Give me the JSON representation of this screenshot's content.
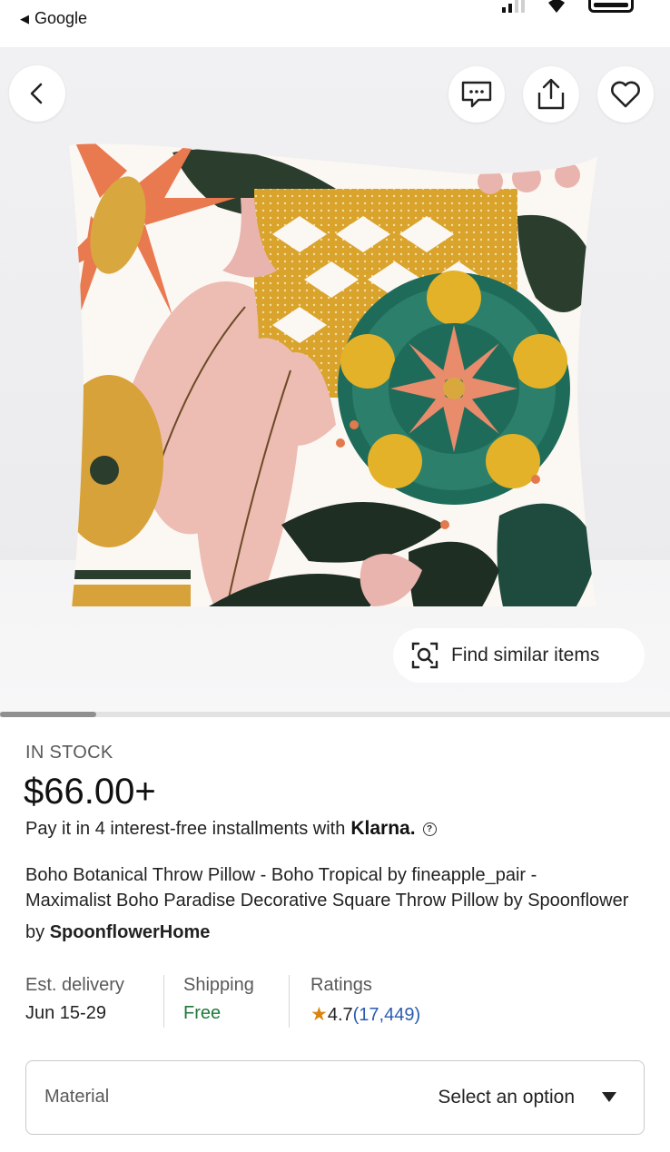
{
  "status_bar": {
    "back_app_label": "Google"
  },
  "hero": {
    "icons": {
      "back": "chevron-left-icon",
      "message": "message-icon",
      "share": "share-icon",
      "favorite": "heart-icon",
      "visual_search": "visual-search-icon"
    },
    "find_similar_label": "Find similar items",
    "image_index": 1
  },
  "product": {
    "stock_status": "IN STOCK",
    "price": "$66.00+",
    "installments_text": "Pay it in 4 interest-free installments with",
    "installments_provider": "Klarna.",
    "title_line1": "Boho Botanical Throw Pillow - Boho Tropical by fineapple_pair -",
    "title_line2": "Maximalist  Boho Paradise Decorative Square Throw Pillow by Spoonflower",
    "seller_prefix": "by",
    "seller_name": "SpoonflowerHome"
  },
  "meta": {
    "delivery_label": "Est. delivery",
    "delivery_value": "Jun 15-29",
    "shipping_label": "Shipping",
    "shipping_value": "Free",
    "ratings_label": "Ratings",
    "rating_value": "4.7",
    "rating_count": "(17,449)"
  },
  "options": {
    "material_label": "Material",
    "material_placeholder": "Select an option"
  },
  "colors": {
    "accent_green": "#1f7a3a",
    "link_blue": "#2a5db0",
    "star": "#d9840f"
  }
}
